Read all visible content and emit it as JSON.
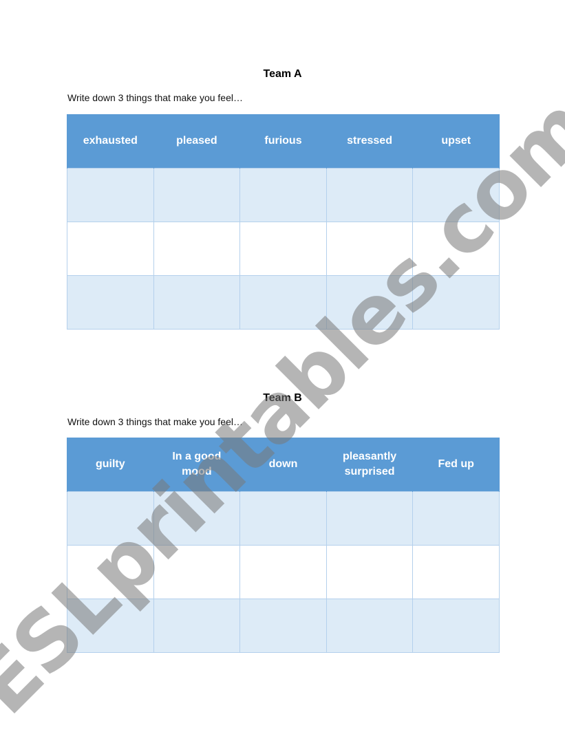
{
  "colors": {
    "header_bg": "#5B9BD5",
    "band_bg": "#DDEBF7",
    "border": "#B4D0EC",
    "watermark": "#787878"
  },
  "sections": [
    {
      "title": "Team A",
      "instruction": "Write down 3 things that make you feel…",
      "columns": [
        "exhausted",
        "pleased",
        "furious",
        "stressed",
        "upset"
      ],
      "rows": [
        [
          "",
          "",
          "",
          "",
          ""
        ],
        [
          "",
          "",
          "",
          "",
          ""
        ],
        [
          "",
          "",
          "",
          "",
          ""
        ]
      ]
    },
    {
      "title": "Team B",
      "instruction": "Write down 3 things that make you feel…",
      "columns": [
        "guilty",
        "In a good mood",
        "down",
        "pleasantly surprised",
        "Fed up"
      ],
      "rows": [
        [
          "",
          "",
          "",
          "",
          ""
        ],
        [
          "",
          "",
          "",
          "",
          ""
        ],
        [
          "",
          "",
          "",
          "",
          ""
        ]
      ]
    }
  ],
  "watermark": "ESLprintables.com"
}
